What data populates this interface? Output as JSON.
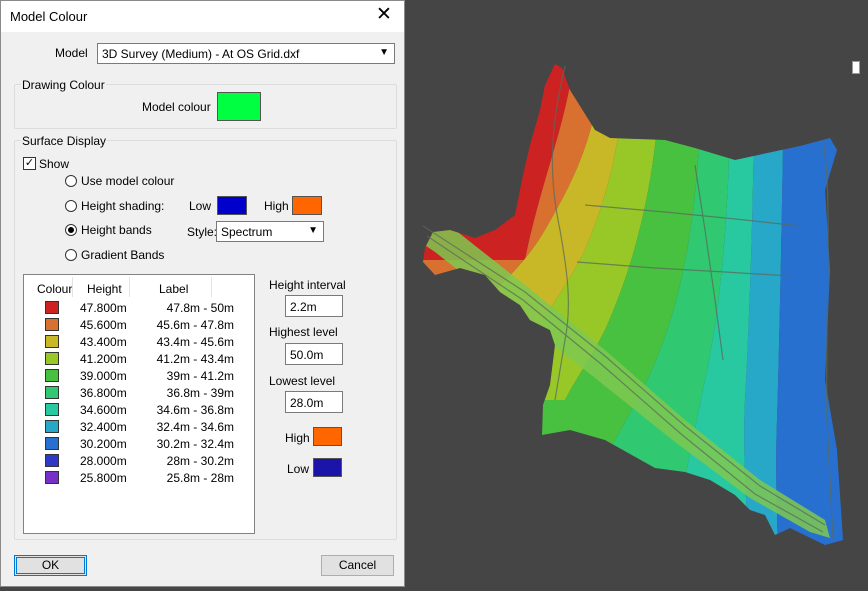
{
  "dialog": {
    "title": "Model Colour",
    "close_glyph": "✕",
    "model_label": "Model",
    "model_value": "3D Survey (Medium) - At OS Grid.dxf",
    "drawing_colour": {
      "group_label": "Drawing Colour",
      "model_colour_label": "Model colour",
      "model_colour": "#00ff40"
    },
    "surface_display": {
      "group_label": "Surface Display",
      "show_label": "Show",
      "show_checked": true,
      "options": [
        "Use model colour",
        "Height shading:",
        "Height bands",
        "Gradient Bands"
      ],
      "selected_option": "Height bands",
      "low_label": "Low",
      "low_colour": "#0000cc",
      "high_label": "High",
      "high_colour": "#ff6600",
      "style_label": "Style:",
      "style_value": "Spectrum"
    },
    "table": {
      "headers": [
        "Colour",
        "Height",
        "Label"
      ],
      "rows": [
        {
          "colour": "#cc2222",
          "height": "47.800m",
          "label": "47.8m - 50m"
        },
        {
          "colour": "#d87030",
          "height": "45.600m",
          "label": "45.6m - 47.8m"
        },
        {
          "colour": "#c8b828",
          "height": "43.400m",
          "label": "43.4m - 45.6m"
        },
        {
          "colour": "#98c828",
          "height": "41.200m",
          "label": "41.2m - 43.4m"
        },
        {
          "colour": "#48c040",
          "height": "39.000m",
          "label": "39m - 41.2m"
        },
        {
          "colour": "#30c870",
          "height": "36.800m",
          "label": "36.8m - 39m"
        },
        {
          "colour": "#28c8a0",
          "height": "34.600m",
          "label": "34.6m - 36.8m"
        },
        {
          "colour": "#28a8c8",
          "height": "32.400m",
          "label": "32.4m - 34.6m"
        },
        {
          "colour": "#2870d0",
          "height": "30.200m",
          "label": "30.2m - 32.4m"
        },
        {
          "colour": "#3038c8",
          "height": "28.000m",
          "label": "28m - 30.2m"
        },
        {
          "colour": "#7830c8",
          "height": "25.800m",
          "label": "25.8m - 28m"
        }
      ]
    },
    "height_interval_label": "Height interval",
    "height_interval": "2.2m",
    "highest_level_label": "Highest level",
    "highest_level": "50.0m",
    "lowest_level_label": "Lowest level",
    "lowest_level": "28.0m",
    "high_label": "High",
    "high_colour": "#ff6600",
    "low_label": "Low",
    "low_colour": "#1a14a8",
    "ok_label": "OK",
    "cancel_label": "Cancel"
  },
  "viewport": {
    "background": "#454545",
    "map_colors": [
      "#cc2222",
      "#d87030",
      "#c8b828",
      "#98c828",
      "#48c040",
      "#30c870",
      "#28c8a0",
      "#28a8c8",
      "#2870d0"
    ]
  }
}
